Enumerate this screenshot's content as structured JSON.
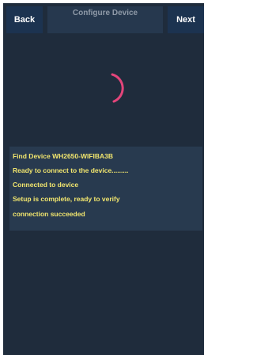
{
  "header": {
    "back_label": "Back",
    "title": "Configure Device",
    "next_label": "Next"
  },
  "spinner": {
    "icon": "loading-spinner-icon",
    "color": "#e2457a"
  },
  "log": {
    "lines": [
      "Find Device WH2650-WIFIBA3B",
      "Ready to connect to the device.........",
      "Connected to device",
      "Setup is complete, ready to verify",
      "connection succeeded"
    ]
  }
}
